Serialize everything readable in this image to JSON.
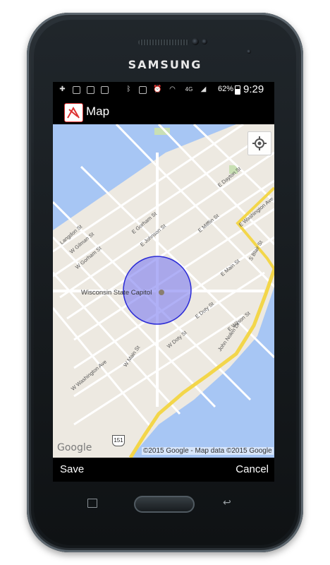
{
  "device": {
    "brand": "SAMSUNG"
  },
  "status_bar": {
    "battery_percent": "62%",
    "battery_level": 0.62,
    "time": "9:29 PM",
    "icons": [
      "plus-icon",
      "calendar-icon",
      "calendar-icon",
      "calendar-icon",
      "bluetooth-icon",
      "nfc-icon",
      "alarm-icon",
      "wifi-icon",
      "4g-lte-icon",
      "signal-icon",
      "battery-icon"
    ]
  },
  "action_bar": {
    "title": "Map",
    "app_icon": "app-logo-icon"
  },
  "map": {
    "poi": "Wisconsin State Capitol",
    "streets": [
      "Langdon St",
      "W Gilman St",
      "W Gorham St",
      "E Gorham St",
      "E Johnson St",
      "E Dayton St",
      "E Mifflin St",
      "E Washington Ave",
      "S Blair St",
      "E Main St",
      "E Wilson St",
      "E Doty St",
      "W Doty St",
      "W Main St",
      "W Washington Ave",
      "John Nolen Dr"
    ],
    "route_shield": "151",
    "google_logo": "Google",
    "copyright": "©2015 Google - Map data ©2015 Google",
    "radius_circle_color": "#7c7cf0",
    "water_color": "#a7c6f4",
    "highway_color": "#f3d64a",
    "my_location_icon": "my-location-icon"
  },
  "bottom_bar": {
    "save_label": "Save",
    "cancel_label": "Cancel"
  },
  "nav_keys": {
    "recents": "recent-apps-icon",
    "home": "home-button",
    "back": "back-icon"
  }
}
